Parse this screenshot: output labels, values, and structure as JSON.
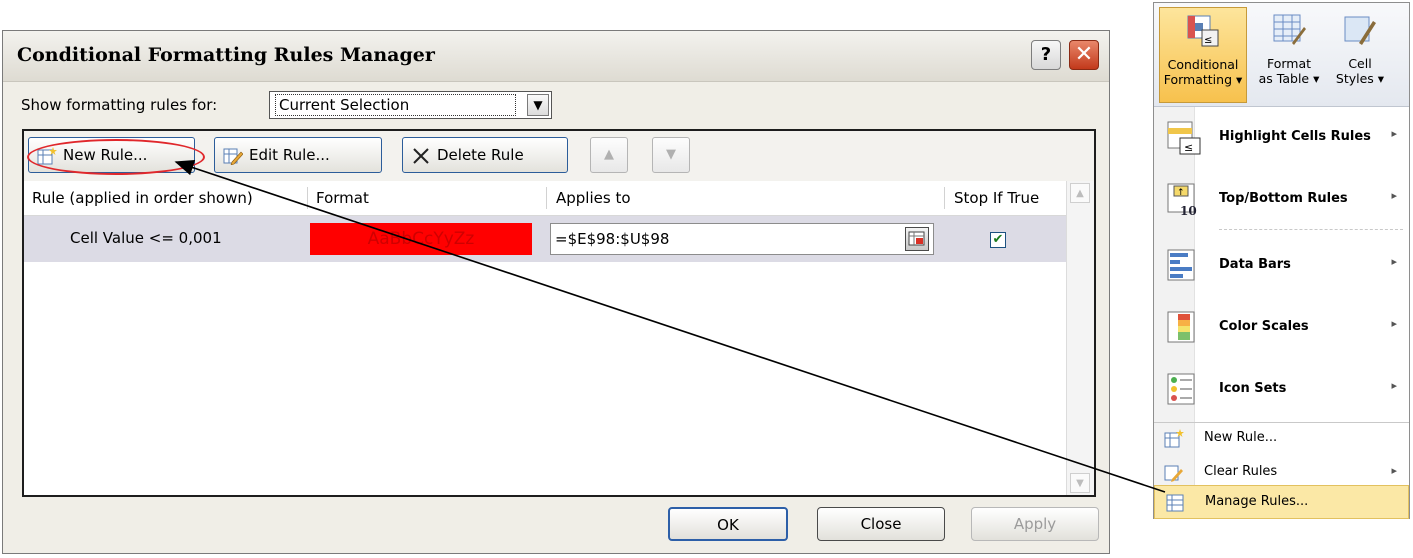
{
  "dialog": {
    "title": "Conditional Formatting Rules Manager",
    "help_label": "?",
    "close_label": "✕",
    "show_label": "Show formatting rules for:",
    "scope_value": "Current Selection",
    "toolbar": {
      "new_rule": "New Rule...",
      "edit_rule": "Edit Rule...",
      "delete_rule": "Delete Rule",
      "move_up": "▲",
      "move_down": "▼"
    },
    "columns": [
      "Rule (applied in order shown)",
      "Format",
      "Applies to",
      "Stop If True"
    ],
    "rule": {
      "condition": "Cell Value <= 0,001",
      "format_preview": "AaBbCcYyZz",
      "applies_to": "=$E$98:$U$98",
      "stop_if_true": true
    },
    "buttons": {
      "ok": "OK",
      "close": "Close",
      "apply": "Apply"
    },
    "colors": {
      "format_fill": "#ff0000",
      "selected_row": "#dcdbe5"
    }
  },
  "ribbon": {
    "buttons": [
      {
        "line1": "Conditional",
        "line2": "Formatting ▾"
      },
      {
        "line1": "Format",
        "line2": "as Table ▾"
      },
      {
        "line1": "Cell",
        "line2": "Styles ▾"
      }
    ],
    "menu": {
      "main_items": [
        "Highlight Cells Rules",
        "Top/Bottom Rules",
        "Data Bars",
        "Color Scales",
        "Icon Sets"
      ],
      "small_items": [
        "New Rule...",
        "Clear Rules",
        "Manage Rules..."
      ],
      "submenu_arrow": "▸"
    },
    "colors": {
      "highlight": "#fbe8a6"
    }
  }
}
